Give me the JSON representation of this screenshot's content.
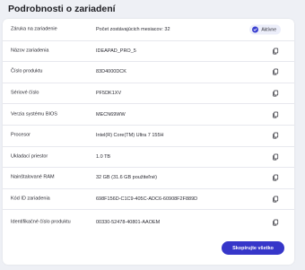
{
  "page": {
    "title": "Podrobnosti o zariadení"
  },
  "rows": [
    {
      "label": "Záruka na zariadenie",
      "value": "Počet zostávajúcich mesiacov: 32",
      "badge": "Aktívne"
    },
    {
      "label": "Názov zariadenia",
      "value": "IDEAPAD_PRO_5"
    },
    {
      "label": "Číslo produktu",
      "value": "83D4000DCK"
    },
    {
      "label": "Sériové číslo",
      "value": "PF5DK1XV"
    },
    {
      "label": "Verzia systému BIOS",
      "value": "MECN69WW"
    },
    {
      "label": "Procesor",
      "value": "Intel(R) Core(TM) Ultra 7 155H"
    },
    {
      "label": "Ukladací priestor",
      "value": "1.0 TB"
    },
    {
      "label": "Nainštalované RAM",
      "value": "32 GB (31.6 GB použiteľné)"
    },
    {
      "label": "Kód ID zariadenia",
      "value": "698F156D-C1C9-405C-ADC6-60908F2F889D"
    },
    {
      "label": "Identifikačné číslo produktu",
      "value": "00330-52478-40801-AAOEM"
    }
  ],
  "actions": {
    "copy_all_label": "Skopírujte všetko"
  },
  "icons": {
    "copy": "copy-icon",
    "badge": "check-circle-icon"
  },
  "colors": {
    "accent": "#3636c9",
    "background": "#eef0f5"
  }
}
